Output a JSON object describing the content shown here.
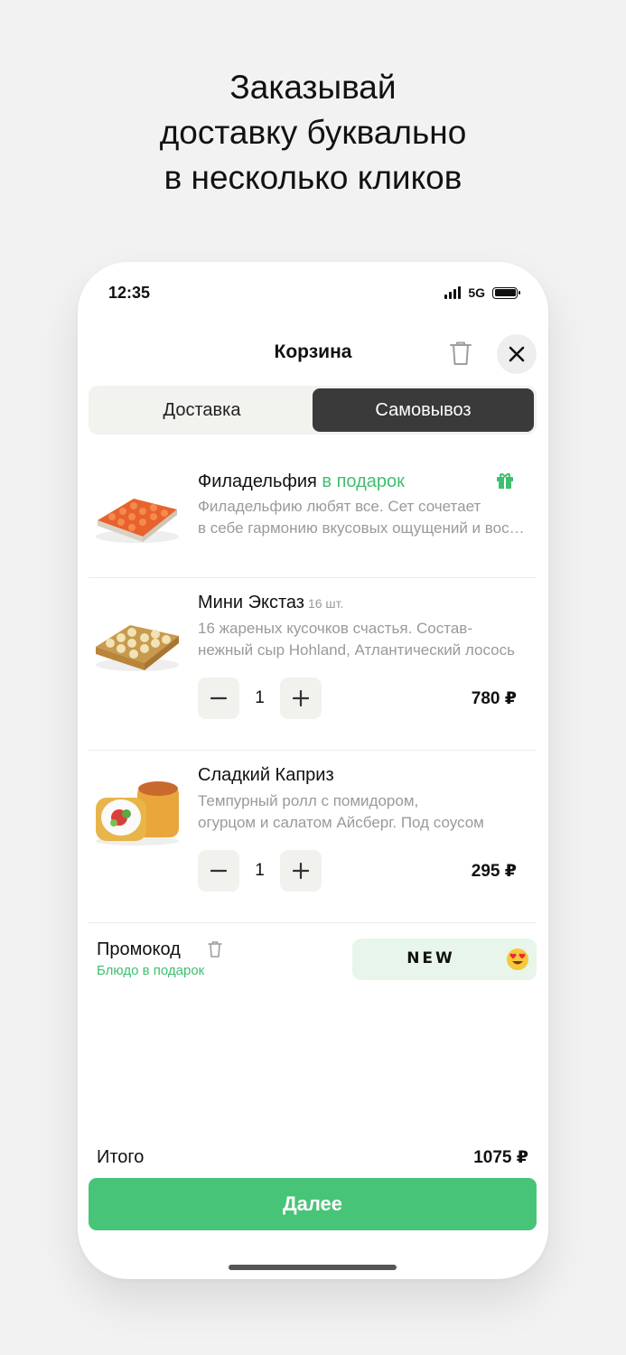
{
  "headline": [
    "Заказывай",
    "доставку буквально",
    "в несколько кликов"
  ],
  "status": {
    "time": "12:35",
    "network": "5G"
  },
  "header": {
    "title": "Корзина"
  },
  "tabs": [
    {
      "label": "Доставка",
      "active": false
    },
    {
      "label": "Самовывоз",
      "active": true
    }
  ],
  "items": [
    {
      "title": "Филадельфия",
      "gift_label": "в подарок",
      "desc_line1": "Филадельфию любят все. Сет сочетает",
      "desc_line2": "в себе гармонию вкусовых ощущений и восторг"
    },
    {
      "title": "Мини Экстаз",
      "count_label": "16 шт.",
      "desc_line1": "16 жареных кусочков счастья. Состав-",
      "desc_line2": "нежный сыр Hohland, Атлантический лосось",
      "quantity": "1",
      "price": "780 ₽"
    },
    {
      "title": "Сладкий Каприз",
      "desc_line1": "Темпурный ролл с помидором,",
      "desc_line2": "огурцом и салатом Айсберг. Под соусом",
      "quantity": "1",
      "price": "295 ₽"
    }
  ],
  "promo": {
    "label": "Промокод",
    "subtitle": "Блюдо в подарок",
    "code": "NEW"
  },
  "total": {
    "label": "Итого",
    "value": "1075 ₽"
  },
  "next_button": "Далее",
  "colors": {
    "accent_green": "#48c478",
    "gift_green": "#3fbf6e",
    "dark_tab": "#3a3a3a"
  },
  "icons": [
    "signal-icon",
    "battery-icon",
    "trash-icon",
    "close-icon",
    "gift-icon",
    "minus-icon",
    "plus-icon",
    "heart-eyes-emoji-icon"
  ]
}
